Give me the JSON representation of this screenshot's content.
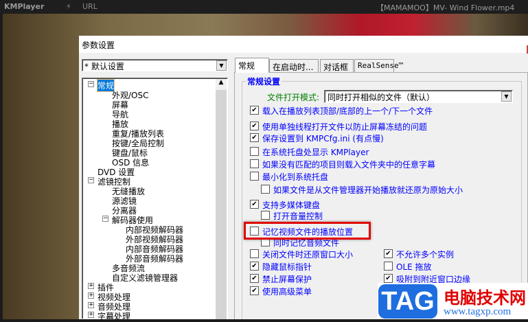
{
  "topbar": {
    "app": "KMPlayer",
    "url": "URL",
    "media_title": "【MAMAMOO】MV- Wind Flower.mp4"
  },
  "dialog": {
    "title": "参数设置",
    "preset": "* 默认设置",
    "tabs": [
      "常规",
      "在启动时...",
      "对话框",
      "RealSense™"
    ],
    "tree": [
      {
        "label": "常规",
        "level": 0,
        "toggle": "-",
        "selected": true
      },
      {
        "label": "外观/OSC",
        "level": 1
      },
      {
        "label": "屏幕",
        "level": 1
      },
      {
        "label": "导航",
        "level": 1
      },
      {
        "label": "播放",
        "level": 1
      },
      {
        "label": "重复/播放列表",
        "level": 1
      },
      {
        "label": "按键/全局控制",
        "level": 1
      },
      {
        "label": "键盘/鼠标",
        "level": 1
      },
      {
        "label": "OSD 信息",
        "level": 1
      },
      {
        "label": "DVD 设置",
        "level": 0
      },
      {
        "label": "滤镜控制",
        "level": 0,
        "toggle": "-"
      },
      {
        "label": "无缝播放",
        "level": 1
      },
      {
        "label": "源滤镜",
        "level": 1
      },
      {
        "label": "分离器",
        "level": 1
      },
      {
        "label": "解码器使用",
        "level": 1,
        "toggle": "-"
      },
      {
        "label": "内部视频解码器",
        "level": 2
      },
      {
        "label": "外部视频解码器",
        "level": 2
      },
      {
        "label": "内部音频解码器",
        "level": 2
      },
      {
        "label": "外部音频解码器",
        "level": 2
      },
      {
        "label": "多音频流",
        "level": 1
      },
      {
        "label": "自定义滤镜管理器",
        "level": 1
      },
      {
        "label": "插件",
        "level": 0,
        "toggle": "+"
      },
      {
        "label": "视频处理",
        "level": 0,
        "toggle": "+"
      },
      {
        "label": "音频处理",
        "level": 0,
        "toggle": "+"
      },
      {
        "label": "字幕处理",
        "level": 0,
        "toggle": "+"
      }
    ],
    "group_title": "常规设置",
    "file_open_mode_label": "文件打开模式:",
    "file_open_mode_value": "同时打开相似的文件（默认）",
    "options": [
      {
        "label": "载入在播放列表顶部/底部的上一个/下一个文件",
        "checked": true
      },
      {
        "label": "使用单独线程打开文件以防止屏幕冻结的问题",
        "checked": true
      },
      {
        "label": "保存设置到 KMPCfg.ini (有点慢)",
        "checked": true
      },
      {
        "label": "在系统托盘处显示 KMPlayer",
        "checked": false
      },
      {
        "label": "如果没有匹配的项目则载入文件夹中的任意字幕",
        "checked": false
      },
      {
        "label": "最小化到系统托盘",
        "checked": false
      },
      {
        "label": "如果文件是从文件管理器开始播放就还原为原始大小",
        "checked": false,
        "indent": true
      },
      {
        "label": "支持多媒体键盘",
        "checked": true
      },
      {
        "label": "打开音量控制",
        "checked": false,
        "indent": true
      },
      {
        "label": "记忆视频文件的播放位置",
        "checked": false,
        "highlighted": true
      },
      {
        "label": "同时记忆音频文件",
        "checked": false,
        "indent": true
      },
      {
        "label": "关闭文件时还原窗口大小",
        "checked": false
      },
      {
        "label": "隐藏鼠标指针",
        "checked": true
      },
      {
        "label": "禁止屏幕保护",
        "checked": true
      },
      {
        "label": "使用高级菜单",
        "checked": true
      }
    ],
    "options_right": [
      {
        "label": "不允许多个实例",
        "checked": true
      },
      {
        "label": "OLE 拖放",
        "checked": false
      },
      {
        "label": "吸附到附近窗口边缘",
        "checked": true
      }
    ]
  },
  "watermark": {
    "logo": "TAG",
    "name": "电脑技术网",
    "url": "www.tagxp.com"
  },
  "colors": {
    "highlight": "#e00000",
    "option_text": "#0000ff",
    "selection": "#0078d7"
  }
}
